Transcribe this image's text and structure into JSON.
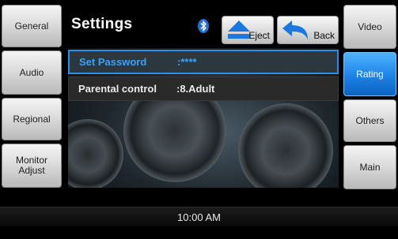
{
  "left_nav": [
    {
      "label": "General"
    },
    {
      "label": "Audio"
    },
    {
      "label": "Regional"
    },
    {
      "label": "Monitor\nAdjust"
    }
  ],
  "right_nav": [
    {
      "label": "Video"
    },
    {
      "label": "Rating"
    },
    {
      "label": "Others"
    },
    {
      "label": "Main"
    }
  ],
  "header": {
    "title": "Settings",
    "eject_label": "Eject",
    "back_label": "Back",
    "bluetooth_icon": "bluetooth-icon"
  },
  "list": {
    "items": [
      {
        "label": "Set Password",
        "value": ":****"
      },
      {
        "label": "Parental control",
        "value": ":8.Adult"
      }
    ]
  },
  "status": {
    "time": "10:00 AM"
  },
  "colors": {
    "accent": "#1d82e6",
    "highlight_text": "#3aa0ff"
  }
}
